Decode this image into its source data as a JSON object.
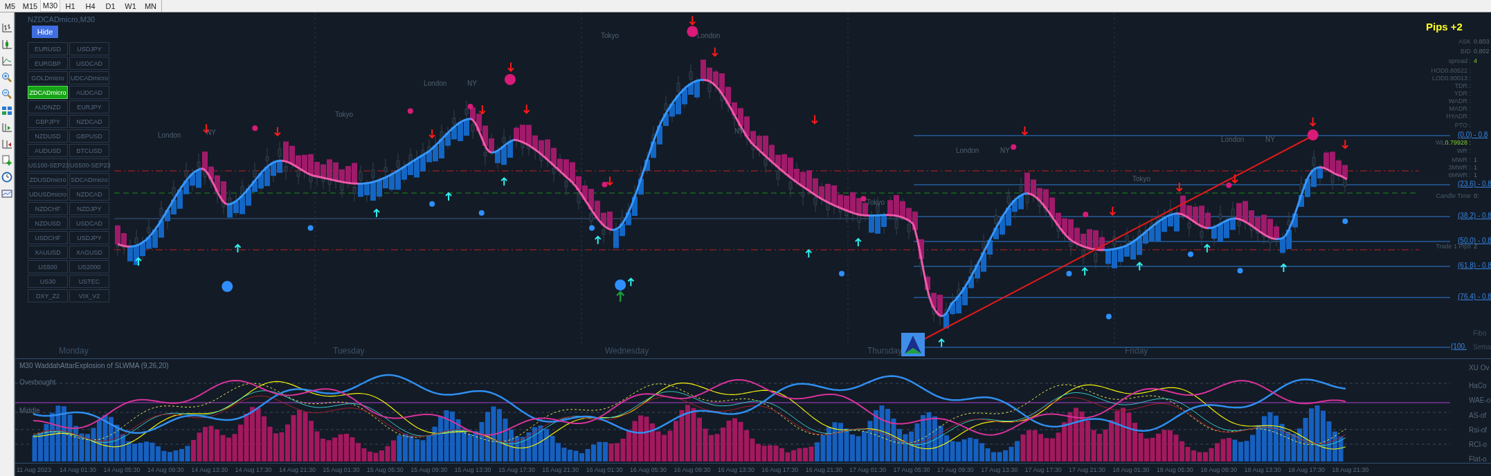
{
  "timeframes": [
    {
      "label": "M5",
      "selected": false
    },
    {
      "label": "M15",
      "selected": false
    },
    {
      "label": "M30",
      "selected": true
    },
    {
      "label": "H1",
      "selected": false
    },
    {
      "label": "H4",
      "selected": false
    },
    {
      "label": "D1",
      "selected": false
    },
    {
      "label": "W1",
      "selected": false
    },
    {
      "label": "MN",
      "selected": false
    }
  ],
  "chart": {
    "title": "NZDCADmicro,M30",
    "hide_button": "Hide",
    "symbols": [
      {
        "label": "EURUSD",
        "selected": false
      },
      {
        "label": "USDJPY",
        "selected": false
      },
      {
        "label": "EURGBP",
        "selected": false
      },
      {
        "label": "USDCAD",
        "selected": false
      },
      {
        "label": "GOLDmicro",
        "selected": false
      },
      {
        "label": "UDCADmicro",
        "selected": false
      },
      {
        "label": "ZDCADmicro",
        "selected": true
      },
      {
        "label": "AUDCAD",
        "selected": false
      },
      {
        "label": "AUDNZD",
        "selected": false
      },
      {
        "label": "EURJPY",
        "selected": false
      },
      {
        "label": "GBPJPY",
        "selected": false
      },
      {
        "label": "NZDCAD",
        "selected": false
      },
      {
        "label": "NZDUSD",
        "selected": false
      },
      {
        "label": "GBPUSD",
        "selected": false
      },
      {
        "label": "AUDUSD",
        "selected": false
      },
      {
        "label": "BTCUSD",
        "selected": false
      },
      {
        "label": "US100-SEP23",
        "selected": false
      },
      {
        "label": "US500-SEP23",
        "selected": false
      },
      {
        "label": "ZDUSDmicro",
        "selected": false
      },
      {
        "label": "SDCADmicro",
        "selected": false
      },
      {
        "label": "UDUSDmicro",
        "selected": false
      },
      {
        "label": "NZDCAD",
        "selected": false
      },
      {
        "label": "NZDCHF",
        "selected": false
      },
      {
        "label": "NZDJPY",
        "selected": false
      },
      {
        "label": "NZDUSD",
        "selected": false
      },
      {
        "label": "USDCAD",
        "selected": false
      },
      {
        "label": "USDCHF",
        "selected": false
      },
      {
        "label": "USDJPY",
        "selected": false
      },
      {
        "label": "XAUUSD",
        "selected": false
      },
      {
        "label": "XAGUSD",
        "selected": false
      },
      {
        "label": "US500",
        "selected": false
      },
      {
        "label": "US2000",
        "selected": false
      },
      {
        "label": "US30",
        "selected": false
      },
      {
        "label": "USTEC",
        "selected": false
      },
      {
        "label": "DXY_Z2",
        "selected": false
      },
      {
        "label": "VIX_V2",
        "selected": false
      }
    ],
    "sessions": [
      "London",
      "NY",
      "Tokyo",
      "London",
      "NY",
      "Tokyo",
      "London",
      "NY",
      "Tokyo",
      "London",
      "NY",
      "Tokyo",
      "London",
      "NY"
    ],
    "days": [
      "Monday",
      "Tuesday",
      "Wednesday",
      "Thursday",
      "Friday"
    ],
    "fib_levels": [
      "(0.0) - 0.8",
      "(23.6) - 0.8",
      "(38.2) - 0.8",
      "(50.0) - 0.8",
      "(61.8) - 0.8",
      "(76.4) - 0.8",
      "(100."
    ],
    "info_panel": {
      "pips": "Pips +2",
      "rows": [
        {
          "label": "ASK",
          "value": "0.803",
          "kind": "plain"
        },
        {
          "label": "BID",
          "value": "0.802",
          "kind": "plain"
        },
        {
          "label": "spread :",
          "value": "4",
          "kind": "accent"
        },
        {
          "label": "HOD0.80522 :",
          "kind": "plain"
        },
        {
          "label": "LOD0.80013 :",
          "kind": "plain"
        },
        {
          "label": "TDR :",
          "kind": "plain"
        },
        {
          "label": "YDR :",
          "kind": "plain"
        },
        {
          "label": "WADR :",
          "kind": "plain"
        },
        {
          "label": "MADR :",
          "kind": "plain"
        },
        {
          "label": "HYADR :",
          "kind": "plain"
        },
        {
          "label": "PTO :",
          "kind": "plain"
        },
        {
          "label": "WL",
          "value": "0.79928 :",
          "kind": "inline"
        },
        {
          "label": "WR :",
          "kind": "plain"
        },
        {
          "label": "MWR :",
          "value": "1",
          "kind": "plain"
        },
        {
          "label": "3MWR :",
          "value": "1",
          "kind": "plain"
        },
        {
          "label": "6MWR :",
          "value": "1",
          "kind": "plain"
        },
        {
          "label": "Candle Time",
          "value": "0:",
          "kind": "plain"
        },
        {
          "label": "Trade 1 Pips",
          "value": "2",
          "kind": "plain"
        },
        {
          "label": "Fibo",
          "kind": "edge"
        },
        {
          "label": "Sema",
          "kind": "edge"
        }
      ]
    }
  },
  "indicator": {
    "title": "M30 WaddahAttarExplosion of SLWMA (9,26,20)",
    "levels": [
      "Overbought",
      "Middle"
    ],
    "legend": [
      "XU Ov",
      "HaCo",
      "WAE-o",
      "AS-of",
      "Rsi-of",
      "RCI-o",
      "Flat-o"
    ]
  },
  "time_axis": [
    "11 Aug 2023",
    "14 Aug 01:30",
    "14 Aug 05:30",
    "14 Aug 09:30",
    "14 Aug 13:30",
    "14 Aug 17:30",
    "14 Aug 21:30",
    "15 Aug 01:30",
    "15 Aug 05:30",
    "15 Aug 09:30",
    "15 Aug 13:30",
    "15 Aug 17:30",
    "15 Aug 21:30",
    "16 Aug 01:30",
    "16 Aug 05:30",
    "16 Aug 09:30",
    "16 Aug 13:30",
    "16 Aug 17:30",
    "16 Aug 21:30",
    "17 Aug 01:30",
    "17 Aug 05:30",
    "17 Aug 09:30",
    "17 Aug 13:30",
    "17 Aug 17:30",
    "17 Aug 21:30",
    "18 Aug 01:30",
    "18 Aug 05:30",
    "18 Aug 09:30",
    "18 Aug 13:30",
    "18 Aug 17:30",
    "18 Aug 21:30"
  ]
}
